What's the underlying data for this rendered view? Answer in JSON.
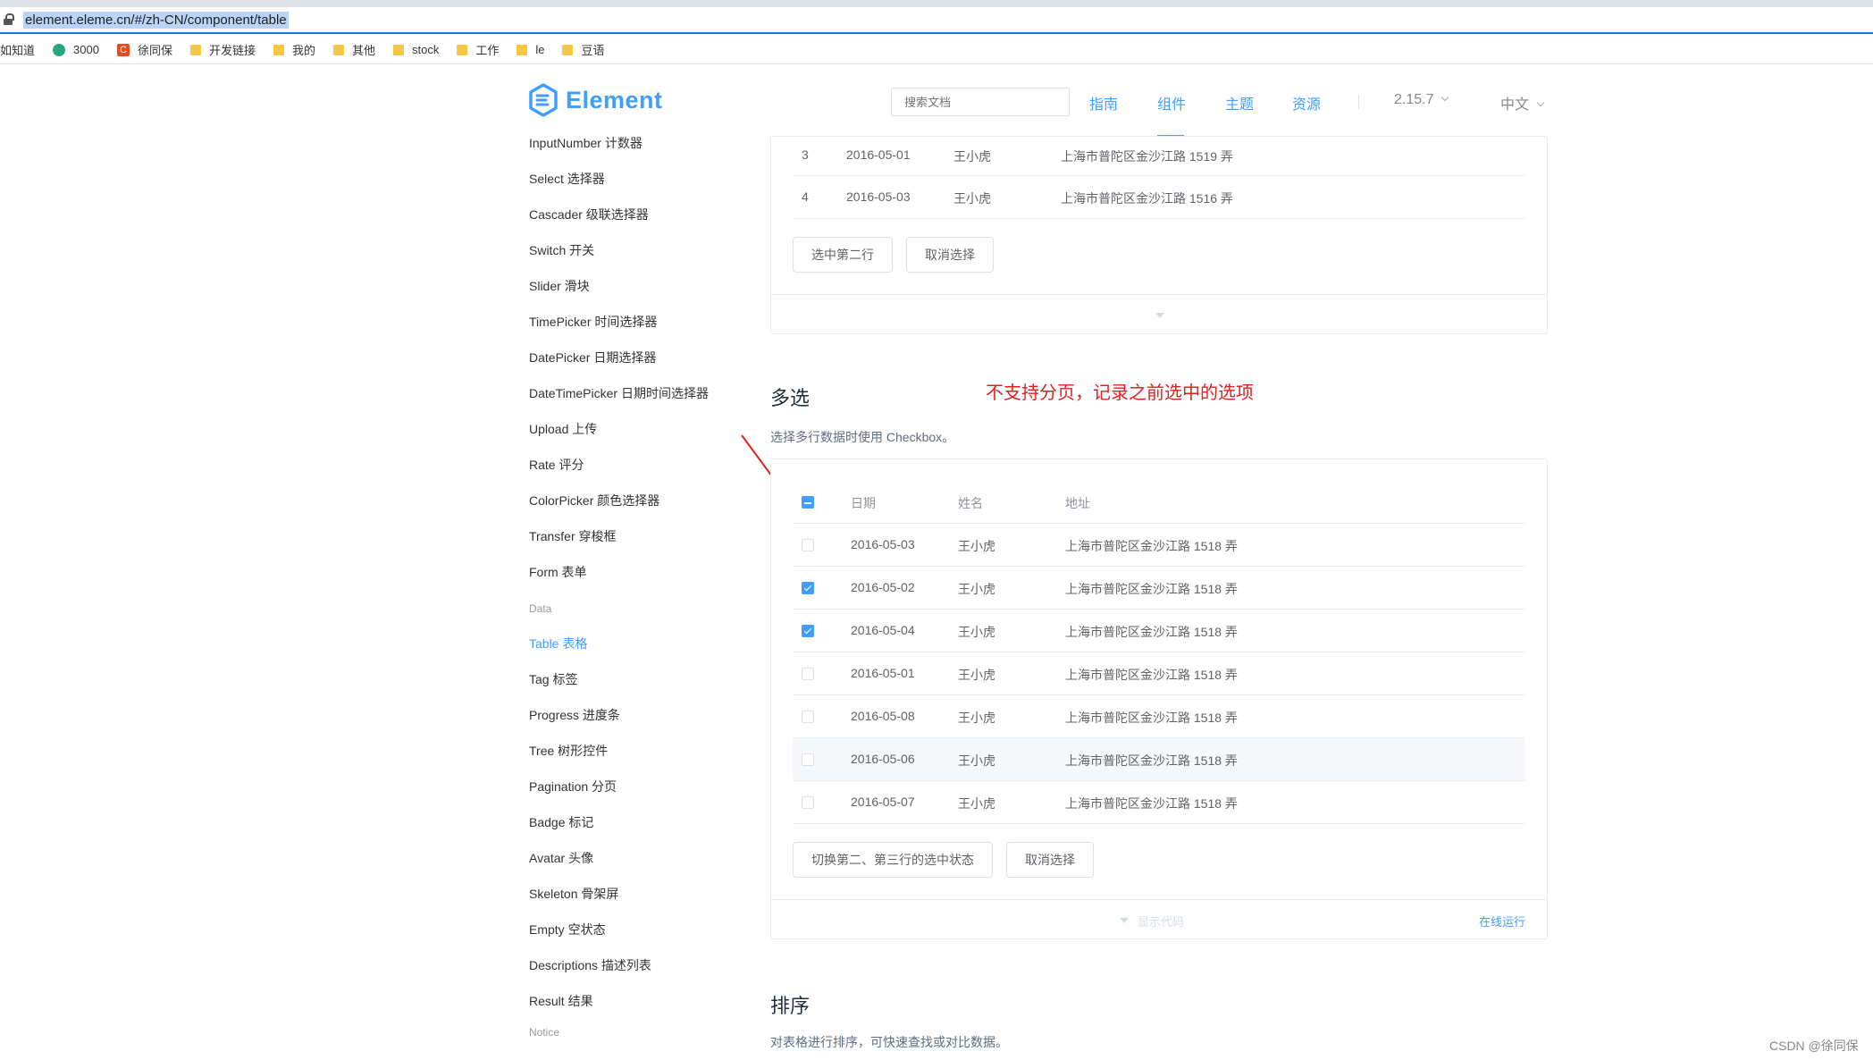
{
  "browser": {
    "url": "element.eleme.cn/#/zh-CN/component/table",
    "bookmarks": [
      {
        "label": "如知道",
        "icon": "none"
      },
      {
        "label": "3000",
        "icon": "green"
      },
      {
        "label": "徐同保",
        "icon": "red",
        "glyph": "C"
      },
      {
        "label": "开发链接",
        "icon": "folder"
      },
      {
        "label": "我的",
        "icon": "folder"
      },
      {
        "label": "其他",
        "icon": "folder"
      },
      {
        "label": "stock",
        "icon": "folder"
      },
      {
        "label": "工作",
        "icon": "folder"
      },
      {
        "label": "le",
        "icon": "folder"
      },
      {
        "label": "豆语",
        "icon": "folder"
      }
    ]
  },
  "header": {
    "logo": "Element",
    "search_placeholder": "搜索文档",
    "nav": [
      "指南",
      "组件",
      "主题",
      "资源"
    ],
    "active_nav": "组件",
    "version": "2.15.7",
    "language": "中文"
  },
  "sidebar": {
    "items": [
      "InputNumber 计数器",
      "Select 选择器",
      "Cascader 级联选择器",
      "Switch 开关",
      "Slider 滑块",
      "TimePicker 时间选择器",
      "DatePicker 日期选择器",
      "DateTimePicker 日期时间选择器",
      "Upload 上传",
      "Rate 评分",
      "ColorPicker 颜色选择器",
      "Transfer 穿梭框",
      "Form 表单"
    ],
    "group_data": "Data",
    "data_items": [
      "Table 表格",
      "Tag 标签",
      "Progress 进度条",
      "Tree 树形控件",
      "Pagination 分页",
      "Badge 标记",
      "Avatar 头像",
      "Skeleton 骨架屏",
      "Empty 空状态",
      "Descriptions 描述列表",
      "Result 结果"
    ],
    "active_item": "Table 表格",
    "group_notice": "Notice"
  },
  "demo1": {
    "rows": [
      {
        "index": "3",
        "date": "2016-05-01",
        "name": "王小虎",
        "address": "上海市普陀区金沙江路 1519 弄"
      },
      {
        "index": "4",
        "date": "2016-05-03",
        "name": "王小虎",
        "address": "上海市普陀区金沙江路 1516 弄"
      }
    ],
    "btn_select_second": "选中第二行",
    "btn_cancel": "取消选择"
  },
  "multi": {
    "title": "多选",
    "desc": "选择多行数据时使用 Checkbox。",
    "annotation": "不支持分页，记录之前选中的选项",
    "headers": {
      "date": "日期",
      "name": "姓名",
      "address": "地址"
    },
    "rows": [
      {
        "date": "2016-05-03",
        "name": "王小虎",
        "address": "上海市普陀区金沙江路 1518 弄",
        "checked": false
      },
      {
        "date": "2016-05-02",
        "name": "王小虎",
        "address": "上海市普陀区金沙江路 1518 弄",
        "checked": true
      },
      {
        "date": "2016-05-04",
        "name": "王小虎",
        "address": "上海市普陀区金沙江路 1518 弄",
        "checked": true
      },
      {
        "date": "2016-05-01",
        "name": "王小虎",
        "address": "上海市普陀区金沙江路 1518 弄",
        "checked": false
      },
      {
        "date": "2016-05-08",
        "name": "王小虎",
        "address": "上海市普陀区金沙江路 1518 弄",
        "checked": false
      },
      {
        "date": "2016-05-06",
        "name": "王小虎",
        "address": "上海市普陀区金沙江路 1518 弄",
        "checked": false
      },
      {
        "date": "2016-05-07",
        "name": "王小虎",
        "address": "上海市普陀区金沙江路 1518 弄",
        "checked": false
      }
    ],
    "btn_toggle": "切换第二、第三行的选中状态",
    "btn_cancel": "取消选择",
    "show_code": "显示代码",
    "run_online": "在线运行"
  },
  "sort": {
    "title": "排序",
    "desc": "对表格进行排序，可快速查找或对比数据。"
  },
  "watermark": "CSDN @徐同保",
  "colors": {
    "primary": "#409eff",
    "annotation": "#e02020"
  }
}
